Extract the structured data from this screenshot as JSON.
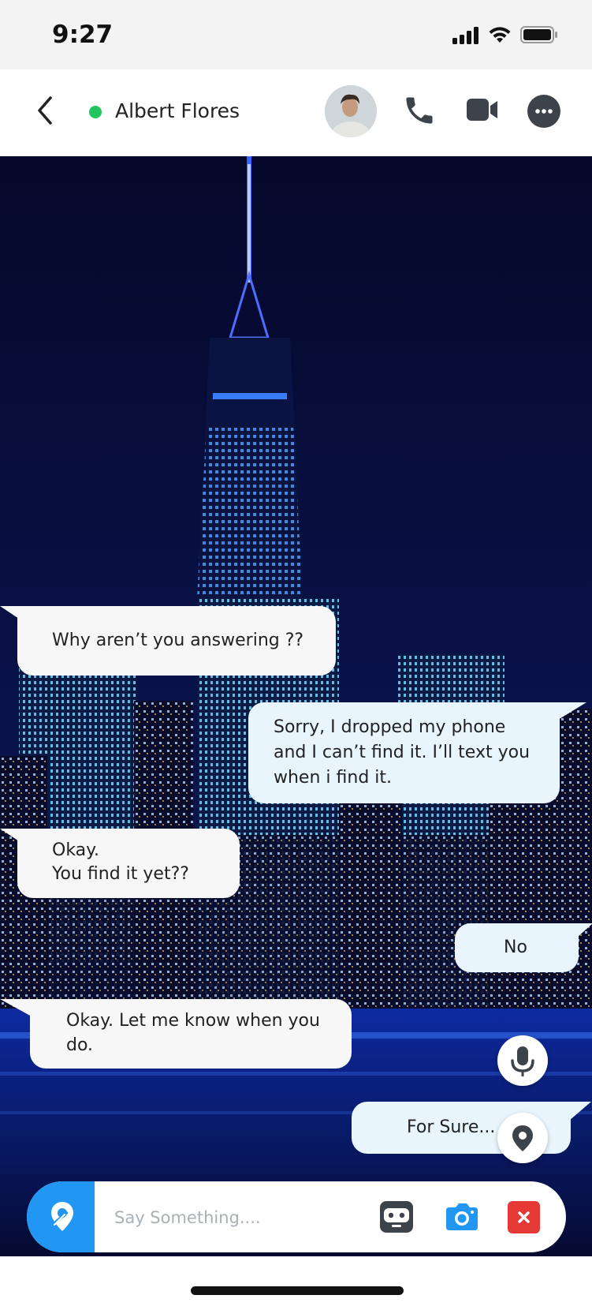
{
  "status_bar": {
    "time": "9:27"
  },
  "header": {
    "contact_name": "Albert Flores",
    "online": true
  },
  "messages": [
    {
      "direction": "incoming",
      "lines": [
        "Why aren’t you answering ??"
      ]
    },
    {
      "direction": "outgoing",
      "lines": [
        "Sorry, I dropped my phone",
        "and I can’t find it. I’ll text you",
        "when i find it."
      ]
    },
    {
      "direction": "incoming",
      "lines": [
        "Okay.",
        "You find it yet??"
      ]
    },
    {
      "direction": "outgoing",
      "lines": [
        "No"
      ]
    },
    {
      "direction": "incoming",
      "lines": [
        "Okay. Let me know when you",
        "do."
      ]
    },
    {
      "direction": "outgoing",
      "lines": [
        "For Sure..."
      ]
    }
  ],
  "composer": {
    "placeholder": "Say Something...."
  },
  "icons": {
    "back": "chevron-left-icon",
    "call": "phone-icon",
    "video": "video-camera-icon",
    "more": "more-dots-icon",
    "mic": "microphone-icon",
    "location": "location-pin-icon",
    "share_location": "location-share-icon",
    "sticker": "robot-icon",
    "camera": "camera-icon",
    "close": "close-icon"
  },
  "colors": {
    "accent": "#2196F3",
    "online": "#22C55E",
    "danger": "#E53935",
    "incoming_bubble": "#F7F7F7",
    "outgoing_bubble": "#E9F5FD"
  }
}
